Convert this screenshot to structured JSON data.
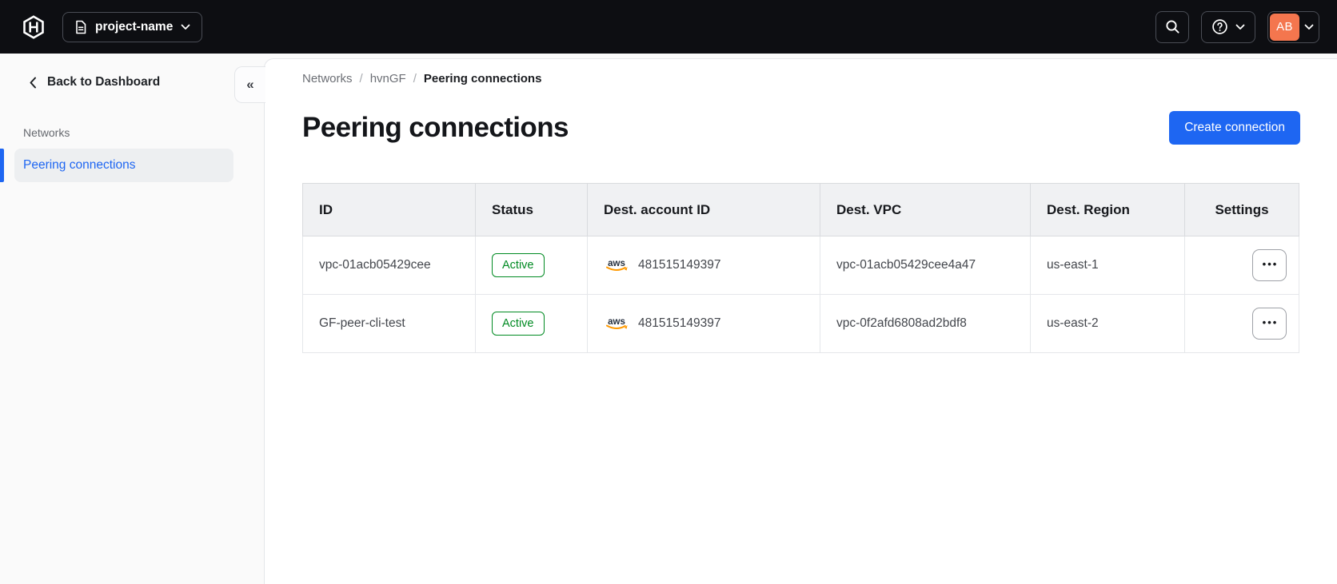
{
  "navbar": {
    "project_name": "project-name",
    "avatar_initials": "AB"
  },
  "sidebar": {
    "back_label": "Back to Dashboard",
    "section_label": "Networks",
    "items": [
      {
        "label": "Peering connections",
        "active": true
      }
    ]
  },
  "breadcrumb": {
    "items": [
      "Networks",
      "hvnGF",
      "Peering connections"
    ],
    "separator": "/"
  },
  "page": {
    "title": "Peering connections",
    "create_button": "Create connection"
  },
  "table": {
    "columns": [
      "ID",
      "Status",
      "Dest. account ID",
      "Dest. VPC",
      "Dest. Region",
      "Settings"
    ],
    "rows": [
      {
        "id": "vpc-01acb05429cee",
        "status": "Active",
        "account_id": "481515149397",
        "vpc": "vpc-01acb05429cee4a47",
        "region": "us-east-1"
      },
      {
        "id": "GF-peer-cli-test",
        "status": "Active",
        "account_id": "481515149397",
        "vpc": "vpc-0f2afd6808ad2bdf8",
        "region": "us-east-2"
      }
    ]
  },
  "icons": {
    "collapse": "«",
    "ellipsis": "•••",
    "aws_word": "aws"
  },
  "colors": {
    "navbar_bg": "#0D0E12",
    "accent_blue": "#1E66F2",
    "success_green": "#008A22",
    "avatar_coral": "#F4764E",
    "aws_orange": "#FF9900",
    "active_item_bg": "#EDEFF1",
    "table_header_bg": "#F0F1F3"
  }
}
